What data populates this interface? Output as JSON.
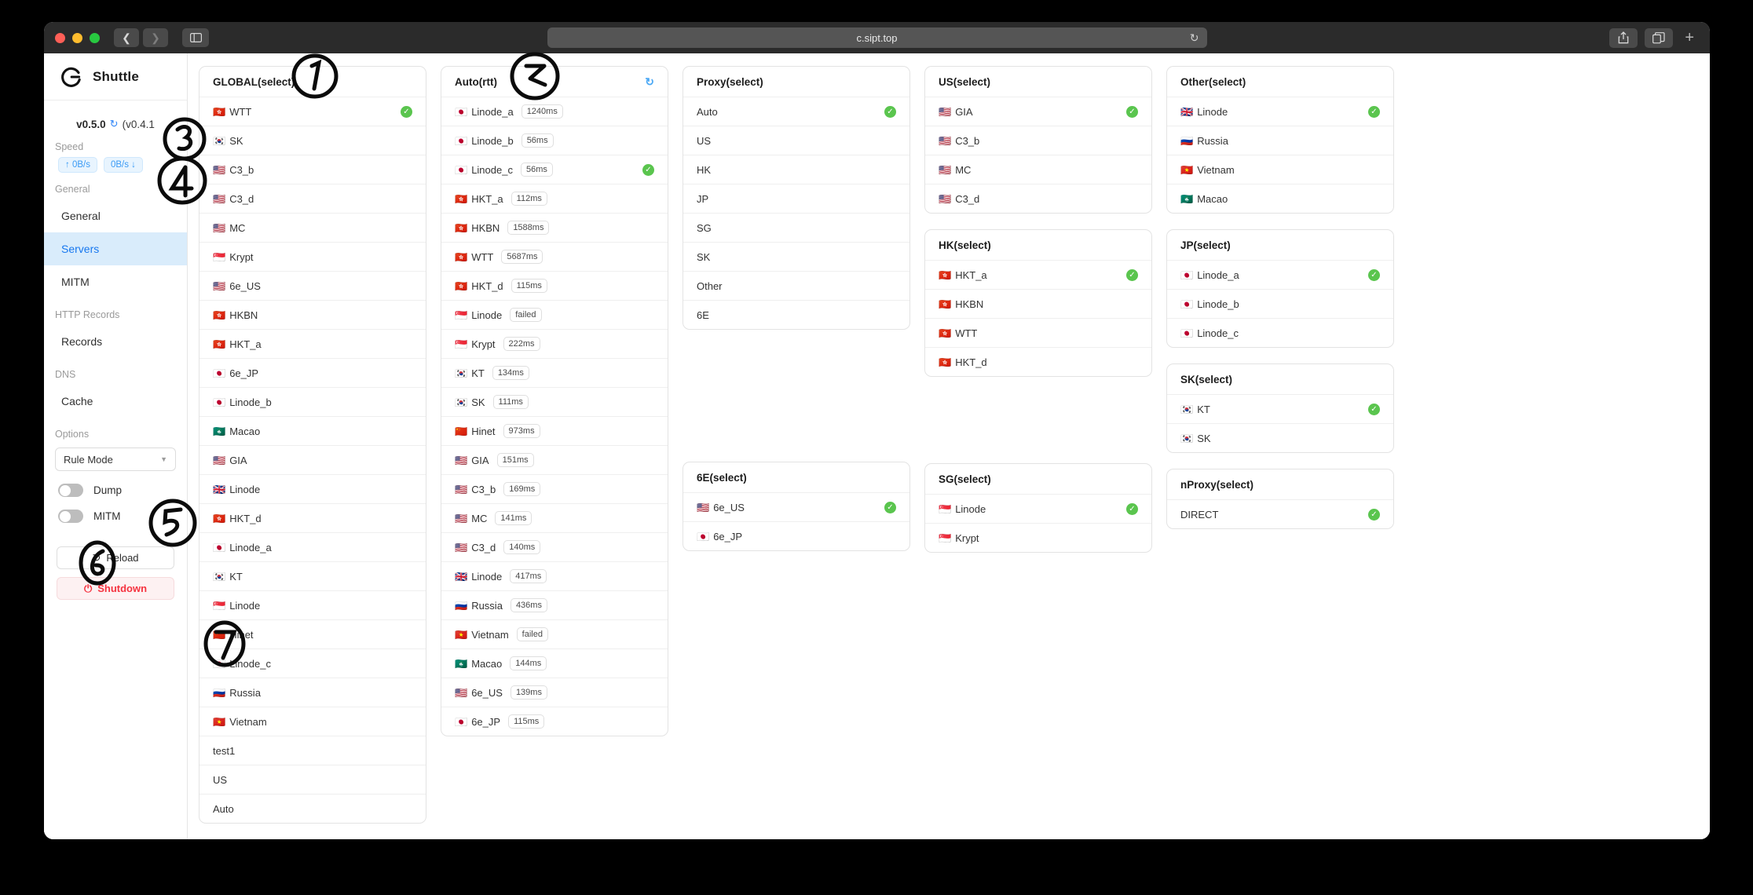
{
  "browser": {
    "url": "c.sipt.top",
    "back_icon": "chevron-left-icon",
    "forward_icon": "chevron-right-icon",
    "sidebar_icon": "sidebar-toggle-icon",
    "reload_icon": "reload-icon",
    "share_icon": "share-icon",
    "tabs_icon": "tab-overview-icon",
    "new_tab_icon": "plus-icon"
  },
  "sidebar": {
    "brand": "Shuttle",
    "version": "v0.5.0",
    "version_sub": "(v0.4.1",
    "speed_label": "Speed",
    "speed_up": "↑ 0B/s",
    "speed_down": "0B/s ↓",
    "groups": [
      {
        "label": "General",
        "items": [
          {
            "label": "General",
            "active": false
          },
          {
            "label": "Servers",
            "active": true
          },
          {
            "label": "MITM",
            "active": false
          }
        ]
      },
      {
        "label": "HTTP Records",
        "items": [
          {
            "label": "Records",
            "active": false
          }
        ]
      },
      {
        "label": "DNS",
        "items": [
          {
            "label": "Cache",
            "active": false
          }
        ]
      }
    ],
    "options_label": "Options",
    "rule_mode": "Rule Mode",
    "toggles": [
      {
        "label": "Dump",
        "on": false
      },
      {
        "label": "MITM",
        "on": false
      }
    ],
    "reload_button": "Reload",
    "shutdown_button": "Shutdown",
    "accent": "#1878ef",
    "danger": "#f5323f"
  },
  "annotations": [
    "1",
    "2",
    "3",
    "4",
    "5",
    "6",
    "7"
  ],
  "board": {
    "columns": [
      {
        "cards": [
          {
            "title": "GLOBAL(select)",
            "refresh": false,
            "scroll": true,
            "rows": [
              {
                "flag": "🇭🇰",
                "name": "WTT",
                "badge": "",
                "selected": true
              },
              {
                "flag": "🇰🇷",
                "name": "SK",
                "badge": "",
                "selected": false
              },
              {
                "flag": "🇺🇸",
                "name": "C3_b",
                "badge": "",
                "selected": false
              },
              {
                "flag": "🇺🇸",
                "name": "C3_d",
                "badge": "",
                "selected": false
              },
              {
                "flag": "🇺🇸",
                "name": "MC",
                "badge": "",
                "selected": false
              },
              {
                "flag": "🇸🇬",
                "name": "Krypt",
                "badge": "",
                "selected": false
              },
              {
                "flag": "🇺🇸",
                "name": "6e_US",
                "badge": "",
                "selected": false
              },
              {
                "flag": "🇭🇰",
                "name": "HKBN",
                "badge": "",
                "selected": false
              },
              {
                "flag": "🇭🇰",
                "name": "HKT_a",
                "badge": "",
                "selected": false
              },
              {
                "flag": "🇯🇵",
                "name": "6e_JP",
                "badge": "",
                "selected": false
              },
              {
                "flag": "🇯🇵",
                "name": "Linode_b",
                "badge": "",
                "selected": false
              },
              {
                "flag": "🇲🇴",
                "name": "Macao",
                "badge": "",
                "selected": false
              },
              {
                "flag": "🇺🇸",
                "name": "GIA",
                "badge": "",
                "selected": false
              },
              {
                "flag": "🇬🇧",
                "name": "Linode",
                "badge": "",
                "selected": false
              },
              {
                "flag": "🇭🇰",
                "name": "HKT_d",
                "badge": "",
                "selected": false
              },
              {
                "flag": "🇯🇵",
                "name": "Linode_a",
                "badge": "",
                "selected": false
              },
              {
                "flag": "🇰🇷",
                "name": "KT",
                "badge": "",
                "selected": false
              },
              {
                "flag": "🇸🇬",
                "name": "Linode",
                "badge": "",
                "selected": false
              },
              {
                "flag": "🇨🇳",
                "name": "Hinet",
                "badge": "",
                "selected": false
              },
              {
                "flag": "🇯🇵",
                "name": "Linode_c",
                "badge": "",
                "selected": false
              },
              {
                "flag": "🇷🇺",
                "name": "Russia",
                "badge": "",
                "selected": false
              },
              {
                "flag": "🇻🇳",
                "name": "Vietnam",
                "badge": "",
                "selected": false
              },
              {
                "flag": "",
                "name": "test1",
                "badge": "",
                "selected": false
              },
              {
                "flag": "",
                "name": "US",
                "badge": "",
                "selected": false
              },
              {
                "flag": "",
                "name": "Auto",
                "badge": "",
                "selected": false
              }
            ]
          }
        ]
      },
      {
        "cards": [
          {
            "title": "Auto(rtt)",
            "refresh": true,
            "scroll": true,
            "rows": [
              {
                "flag": "🇯🇵",
                "name": "Linode_a",
                "badge": "1240ms",
                "selected": false
              },
              {
                "flag": "🇯🇵",
                "name": "Linode_b",
                "badge": "56ms",
                "selected": false
              },
              {
                "flag": "🇯🇵",
                "name": "Linode_c",
                "badge": "56ms",
                "selected": true
              },
              {
                "flag": "🇭🇰",
                "name": "HKT_a",
                "badge": "112ms",
                "selected": false
              },
              {
                "flag": "🇭🇰",
                "name": "HKBN",
                "badge": "1588ms",
                "selected": false
              },
              {
                "flag": "🇭🇰",
                "name": "WTT",
                "badge": "5687ms",
                "selected": false
              },
              {
                "flag": "🇭🇰",
                "name": "HKT_d",
                "badge": "115ms",
                "selected": false
              },
              {
                "flag": "🇸🇬",
                "name": "Linode",
                "badge": "failed",
                "selected": false
              },
              {
                "flag": "🇸🇬",
                "name": "Krypt",
                "badge": "222ms",
                "selected": false
              },
              {
                "flag": "🇰🇷",
                "name": "KT",
                "badge": "134ms",
                "selected": false
              },
              {
                "flag": "🇰🇷",
                "name": "SK",
                "badge": "111ms",
                "selected": false
              },
              {
                "flag": "🇨🇳",
                "name": "Hinet",
                "badge": "973ms",
                "selected": false
              },
              {
                "flag": "🇺🇸",
                "name": "GIA",
                "badge": "151ms",
                "selected": false
              },
              {
                "flag": "🇺🇸",
                "name": "C3_b",
                "badge": "169ms",
                "selected": false
              },
              {
                "flag": "🇺🇸",
                "name": "MC",
                "badge": "141ms",
                "selected": false
              },
              {
                "flag": "🇺🇸",
                "name": "C3_d",
                "badge": "140ms",
                "selected": false
              },
              {
                "flag": "🇬🇧",
                "name": "Linode",
                "badge": "417ms",
                "selected": false
              },
              {
                "flag": "🇷🇺",
                "name": "Russia",
                "badge": "436ms",
                "selected": false
              },
              {
                "flag": "🇻🇳",
                "name": "Vietnam",
                "badge": "failed",
                "selected": false
              },
              {
                "flag": "🇲🇴",
                "name": "Macao",
                "badge": "144ms",
                "selected": false
              },
              {
                "flag": "🇺🇸",
                "name": "6e_US",
                "badge": "139ms",
                "selected": false
              },
              {
                "flag": "🇯🇵",
                "name": "6e_JP",
                "badge": "115ms",
                "selected": false
              }
            ]
          }
        ]
      },
      {
        "cards": [
          {
            "title": "Proxy(select)",
            "refresh": false,
            "scroll": false,
            "rows": [
              {
                "flag": "",
                "name": "Auto",
                "badge": "",
                "selected": true
              },
              {
                "flag": "",
                "name": "US",
                "badge": "",
                "selected": false
              },
              {
                "flag": "",
                "name": "HK",
                "badge": "",
                "selected": false
              },
              {
                "flag": "",
                "name": "JP",
                "badge": "",
                "selected": false
              },
              {
                "flag": "",
                "name": "SG",
                "badge": "",
                "selected": false
              },
              {
                "flag": "",
                "name": "SK",
                "badge": "",
                "selected": false
              },
              {
                "flag": "",
                "name": "Other",
                "badge": "",
                "selected": false
              },
              {
                "flag": "",
                "name": "6E",
                "badge": "",
                "selected": false
              }
            ]
          },
          {
            "title": "6E(select)",
            "refresh": false,
            "scroll": false,
            "spacer_before": 128,
            "rows": [
              {
                "flag": "🇺🇸",
                "name": "6e_US",
                "badge": "",
                "selected": true
              },
              {
                "flag": "🇯🇵",
                "name": "6e_JP",
                "badge": "",
                "selected": false
              }
            ]
          }
        ]
      },
      {
        "cards": [
          {
            "title": "US(select)",
            "refresh": false,
            "scroll": false,
            "rows": [
              {
                "flag": "🇺🇸",
                "name": "GIA",
                "badge": "",
                "selected": true
              },
              {
                "flag": "🇺🇸",
                "name": "C3_b",
                "badge": "",
                "selected": false
              },
              {
                "flag": "🇺🇸",
                "name": "MC",
                "badge": "",
                "selected": false
              },
              {
                "flag": "🇺🇸",
                "name": "C3_d",
                "badge": "",
                "selected": false
              }
            ]
          },
          {
            "title": "HK(select)",
            "refresh": false,
            "scroll": false,
            "rows": [
              {
                "flag": "🇭🇰",
                "name": "HKT_a",
                "badge": "",
                "selected": true
              },
              {
                "flag": "🇭🇰",
                "name": "HKBN",
                "badge": "",
                "selected": false
              },
              {
                "flag": "🇭🇰",
                "name": "WTT",
                "badge": "",
                "selected": false
              },
              {
                "flag": "🇭🇰",
                "name": "HKT_d",
                "badge": "",
                "selected": false
              }
            ]
          },
          {
            "title": "SG(select)",
            "refresh": false,
            "scroll": false,
            "spacer_before": 70,
            "rows": [
              {
                "flag": "🇸🇬",
                "name": "Linode",
                "badge": "",
                "selected": true
              },
              {
                "flag": "🇸🇬",
                "name": "Krypt",
                "badge": "",
                "selected": false
              }
            ]
          }
        ]
      },
      {
        "cards": [
          {
            "title": "Other(select)",
            "refresh": false,
            "scroll": false,
            "rows": [
              {
                "flag": "🇬🇧",
                "name": "Linode",
                "badge": "",
                "selected": true
              },
              {
                "flag": "🇷🇺",
                "name": "Russia",
                "badge": "",
                "selected": false
              },
              {
                "flag": "🇻🇳",
                "name": "Vietnam",
                "badge": "",
                "selected": false
              },
              {
                "flag": "🇲🇴",
                "name": "Macao",
                "badge": "",
                "selected": false
              }
            ]
          },
          {
            "title": "JP(select)",
            "refresh": false,
            "scroll": false,
            "rows": [
              {
                "flag": "🇯🇵",
                "name": "Linode_a",
                "badge": "",
                "selected": true
              },
              {
                "flag": "🇯🇵",
                "name": "Linode_b",
                "badge": "",
                "selected": false
              },
              {
                "flag": "🇯🇵",
                "name": "Linode_c",
                "badge": "",
                "selected": false
              }
            ]
          },
          {
            "title": "SK(select)",
            "refresh": false,
            "scroll": false,
            "rows": [
              {
                "flag": "🇰🇷",
                "name": "KT",
                "badge": "",
                "selected": true
              },
              {
                "flag": "🇰🇷",
                "name": "SK",
                "badge": "",
                "selected": false
              }
            ]
          },
          {
            "title": "nProxy(select)",
            "refresh": false,
            "scroll": false,
            "rows": [
              {
                "flag": "",
                "name": "DIRECT",
                "badge": "",
                "selected": true
              }
            ]
          }
        ]
      }
    ]
  }
}
